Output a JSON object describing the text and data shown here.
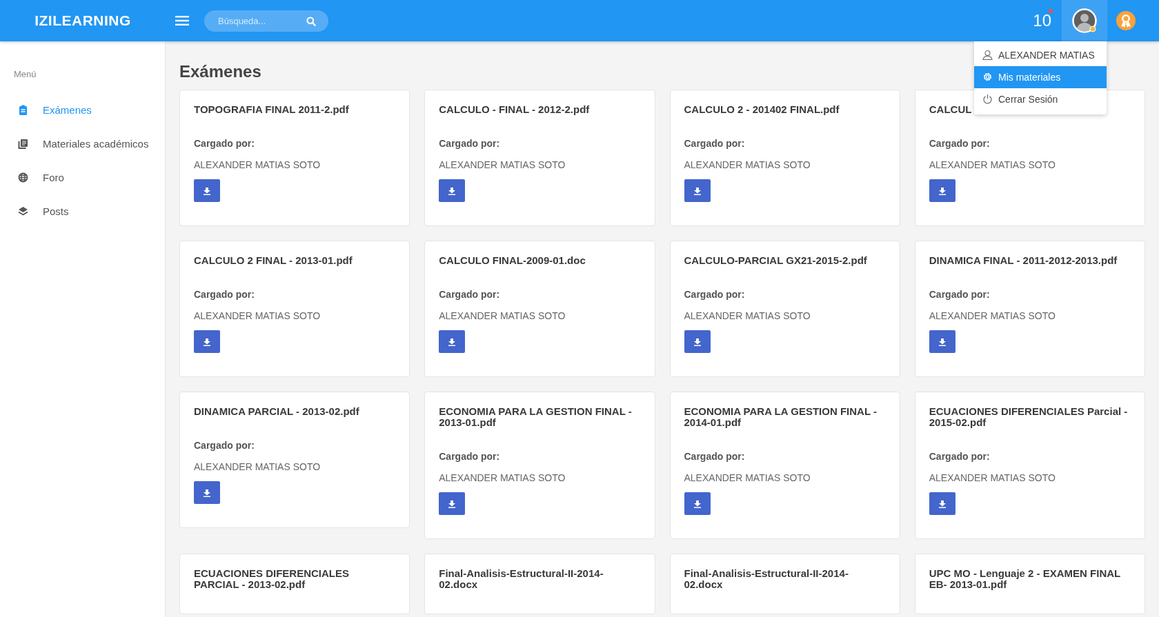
{
  "header": {
    "logo": "IZILEARNING",
    "search": {
      "placeholder": "Búsqueda..."
    },
    "notification_count": "10",
    "notification_unread": true
  },
  "user_menu": {
    "open": true,
    "items": [
      {
        "kind": "user",
        "label": "ALEXANDER MATIAS",
        "selected": false
      },
      {
        "kind": "settings",
        "label": "Mis materiales",
        "selected": true
      },
      {
        "kind": "logout",
        "label": "Cerrar Sesión",
        "selected": false
      }
    ]
  },
  "sidebar": {
    "heading": "Menú",
    "items": [
      {
        "kind": "clipboard",
        "label": "Exámenes",
        "selected": true
      },
      {
        "kind": "books",
        "label": "Materiales académicos",
        "selected": false
      },
      {
        "kind": "globe",
        "label": "Foro",
        "selected": false
      },
      {
        "kind": "layers",
        "label": "Posts",
        "selected": false
      }
    ]
  },
  "page_title": "Exámenes",
  "cards": [
    {
      "title": "TOPOGRAFIA FINAL 2011-2.pdf",
      "uploaded_label": "Cargado por:",
      "uploader": "ALEXANDER MATIAS SOTO"
    },
    {
      "title": "CALCULO - FINAL - 2012-2.pdf",
      "uploaded_label": "Cargado por:",
      "uploader": "ALEXANDER MATIAS SOTO"
    },
    {
      "title": "CALCULO 2 - 201402 FINAL.pdf",
      "uploaded_label": "Cargado por:",
      "uploader": "ALEXANDER MATIAS SOTO"
    },
    {
      "title": "CALCUL",
      "uploaded_label": "Cargado por:",
      "uploader": "ALEXANDER MATIAS SOTO"
    },
    {
      "title": "CALCULO 2 FINAL - 2013-01.pdf",
      "uploaded_label": "Cargado por:",
      "uploader": "ALEXANDER MATIAS SOTO"
    },
    {
      "title": "CALCULO FINAL-2009-01.doc",
      "uploaded_label": "Cargado por:",
      "uploader": "ALEXANDER MATIAS SOTO"
    },
    {
      "title": "CALCULO-PARCIAL GX21-2015-2.pdf",
      "uploaded_label": "Cargado por:",
      "uploader": "ALEXANDER MATIAS SOTO"
    },
    {
      "title": "DINAMICA FINAL - 2011-2012-2013.pdf",
      "uploaded_label": "Cargado por:",
      "uploader": "ALEXANDER MATIAS SOTO"
    },
    {
      "title": "DINAMICA PARCIAL - 2013-02.pdf",
      "uploaded_label": "Cargado por:",
      "uploader": "ALEXANDER MATIAS SOTO"
    },
    {
      "title": "ECONOMIA PARA LA GESTION FINAL - 2013-01.pdf",
      "uploaded_label": "Cargado por:",
      "uploader": "ALEXANDER MATIAS SOTO"
    },
    {
      "title": "ECONOMIA PARA LA GESTION FINAL - 2014-01.pdf",
      "uploaded_label": "Cargado por:",
      "uploader": "ALEXANDER MATIAS SOTO"
    },
    {
      "title": "ECUACIONES DIFERENCIALES Parcial - 2015-02.pdf",
      "uploaded_label": "Cargado por:",
      "uploader": "ALEXANDER MATIAS SOTO"
    },
    {
      "title": "ECUACIONES DIFERENCIALES PARCIAL - 2013-02.pdf"
    },
    {
      "title": "Final-Analisis-Estructural-II-2014-02.docx"
    },
    {
      "title": "Final-Analisis-Estructural-II-2014-02.docx"
    },
    {
      "title": "UPC MO - Lenguaje 2 - EXAMEN FINAL EB- 2013-01.pdf"
    }
  ]
}
